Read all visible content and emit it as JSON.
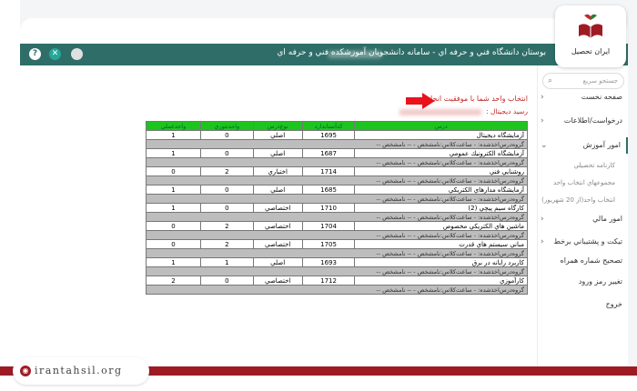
{
  "app": {
    "title": "بوستان دانشگاه فني و حرفه اي - سامانه دانشجويان آموزشكده فني و حرفه اي",
    "help_glyph": "?",
    "close_glyph": "✕"
  },
  "colors": {
    "topbar": "#2f6e68",
    "table_header": "#1ec41e",
    "group_row": "#bdbdbd",
    "alert_text": "#c62828",
    "brand_red": "#9e1b24"
  },
  "sidebar": {
    "search_placeholder": "جستجو سريع",
    "items": [
      {
        "label": "صفحه نخست",
        "chevron": "‹"
      },
      {
        "label": "درخواست/اطلاعات",
        "chevron": "‹"
      },
      {
        "label": "امور آموزش",
        "chevron": "⌄"
      },
      {
        "label": "كارنامه تحصيلي",
        "chevron": ""
      },
      {
        "label": "مجموعهاي انتخاب واحد",
        "chevron": ""
      },
      {
        "label": "انتخاب واحد(از 20 شهريور)",
        "chevron": ""
      },
      {
        "label": "امور مالي",
        "chevron": "‹"
      },
      {
        "label": "تيكت و پشتيباني برخط",
        "chevron": "‹"
      },
      {
        "label": "تصحيح شماره همراه",
        "chevron": ""
      },
      {
        "label": "تغيير رمز ورود",
        "chevron": ""
      },
      {
        "label": "خروج",
        "chevron": ""
      }
    ]
  },
  "main": {
    "success_message": "انتخاب واحد شما با موفقيت انجام شد",
    "receipt_label": "رسيد ديجيتال :"
  },
  "table": {
    "headers": [
      "درس",
      "كدآستاندارد",
      "نوع‌درس",
      "واحدتئوري",
      "واحدعملي"
    ],
    "group_text": "گروه‌درس‌اخذشده: - ساعت‌كلاس:نامشخص - -- نامشخص --",
    "rows": [
      {
        "name": "آزمايشگاه ديجيتال",
        "code": "1695",
        "type": "اصلي",
        "theory": "0",
        "practical": "1"
      },
      {
        "name": "آزمايشگاه الكترونيك عمومي",
        "code": "1687",
        "type": "اصلي",
        "theory": "0",
        "practical": "1"
      },
      {
        "name": "روشنايي فني",
        "code": "1714",
        "type": "اختياري",
        "theory": "2",
        "practical": "0"
      },
      {
        "name": "آزمايشگاه مدارهاي الكتريكي",
        "code": "1685",
        "type": "اصلي",
        "theory": "0",
        "practical": "1"
      },
      {
        "name": "كارگاه سيم پيچي (2)",
        "code": "1710",
        "type": "اختصاصي",
        "theory": "0",
        "practical": "1"
      },
      {
        "name": "ماشين هاي الكتريكي مخصوص",
        "code": "1704",
        "type": "اختصاصي",
        "theory": "2",
        "practical": "0"
      },
      {
        "name": "مباني سيستم هاي قدرت",
        "code": "1705",
        "type": "اختصاصي",
        "theory": "2",
        "practical": "0"
      },
      {
        "name": "كاربرد رايانه در برق",
        "code": "1693",
        "type": "اصلي",
        "theory": "1",
        "practical": "1"
      },
      {
        "name": "كارآموزي",
        "code": "1712",
        "type": "اختصاصي",
        "theory": "0",
        "practical": "2"
      }
    ]
  },
  "watermark": {
    "logo_text": "ایران تحصیل",
    "site_url": "irantahsil.org"
  }
}
